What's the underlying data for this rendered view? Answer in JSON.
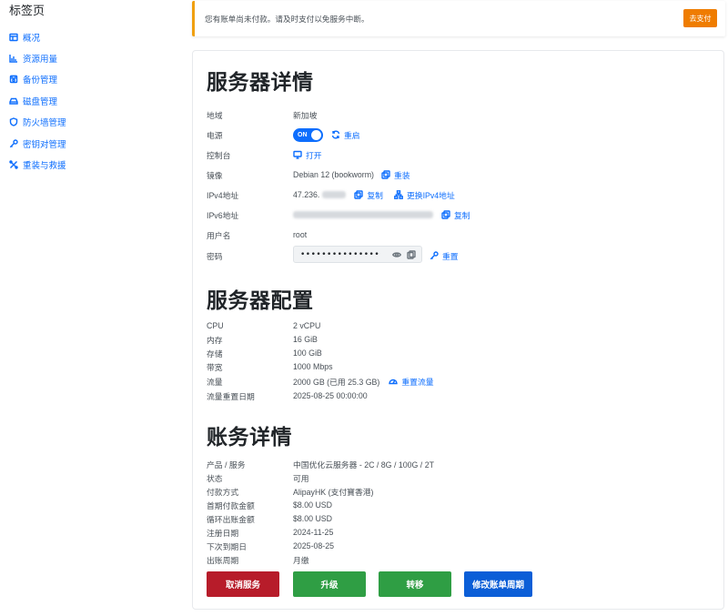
{
  "sidebar": {
    "title": "标签页",
    "items": [
      {
        "label": "概况",
        "icon": "dashboard-icon"
      },
      {
        "label": "资源用量",
        "icon": "bar-chart-icon"
      },
      {
        "label": "备份管理",
        "icon": "backup-icon"
      },
      {
        "label": "磁盘管理",
        "icon": "disk-icon"
      },
      {
        "label": "防火墙管理",
        "icon": "shield-icon"
      },
      {
        "label": "密钥对管理",
        "icon": "key-icon"
      },
      {
        "label": "重装与救援",
        "icon": "tools-icon"
      }
    ]
  },
  "alert": {
    "message": "您有账单尚未付款。请及时支付以免服务中断。",
    "button": "去支付",
    "accent": "#f0a010"
  },
  "server_details": {
    "heading": "服务器详情",
    "region_label": "地域",
    "region": "新加坡",
    "power_label": "电源",
    "power_state": "ON",
    "restart": "重启",
    "console_label": "控制台",
    "console_open": "打开",
    "image_label": "镜像",
    "image": "Debian 12 (bookworm)",
    "reinstall": "重装",
    "ipv4_label": "IPv4地址",
    "ipv4_visible": "47.236.",
    "copy": "复制",
    "change_ipv4": "更换IPv4地址",
    "ipv6_label": "IPv6地址",
    "copy_v6": "复制",
    "username_label": "用户名",
    "username": "root",
    "password_label": "密码",
    "password_masked": "•••••••••••••••",
    "reset": "重置"
  },
  "server_config": {
    "heading": "服务器配置",
    "cpu_label": "CPU",
    "cpu": "2 vCPU",
    "memory_label": "内存",
    "memory": "16 GiB",
    "storage_label": "存储",
    "storage": "100 GiB",
    "bandwidth_label": "带宽",
    "bandwidth": "1000 Mbps",
    "traffic_label": "流量",
    "traffic": "2000 GB (已用 25.3 GB)",
    "reset_traffic": "重置流量",
    "traffic_reset_date_label": "流量重置日期",
    "traffic_reset_date": "2025-08-25 00:00:00"
  },
  "billing": {
    "heading": "账务详情",
    "product_label": "产品 / 服务",
    "product": "中国优化云服务器 - 2C / 8G / 100G / 2T",
    "status_label": "状态",
    "status": "可用",
    "payment_label": "付款方式",
    "payment": "AlipayHK (支付寶香港)",
    "first_amount_label": "首期付款金额",
    "first_amount": "$8.00 USD",
    "recurring_label": "循环出账金额",
    "recurring": "$8.00 USD",
    "reg_date_label": "注册日期",
    "reg_date": "2024-11-25",
    "due_date_label": "下次到期日",
    "due_date": "2025-08-25",
    "cycle_label": "出账周期",
    "cycle": "月缴"
  },
  "actions": {
    "cancel": "取消服务",
    "upgrade": "升级",
    "transfer": "转移",
    "change_cycle": "修改账单周期",
    "colors": {
      "cancel": "#b71c2a",
      "upgrade": "#2f9e44",
      "transfer": "#2f9e44",
      "change_cycle": "#0b5ed7"
    }
  }
}
